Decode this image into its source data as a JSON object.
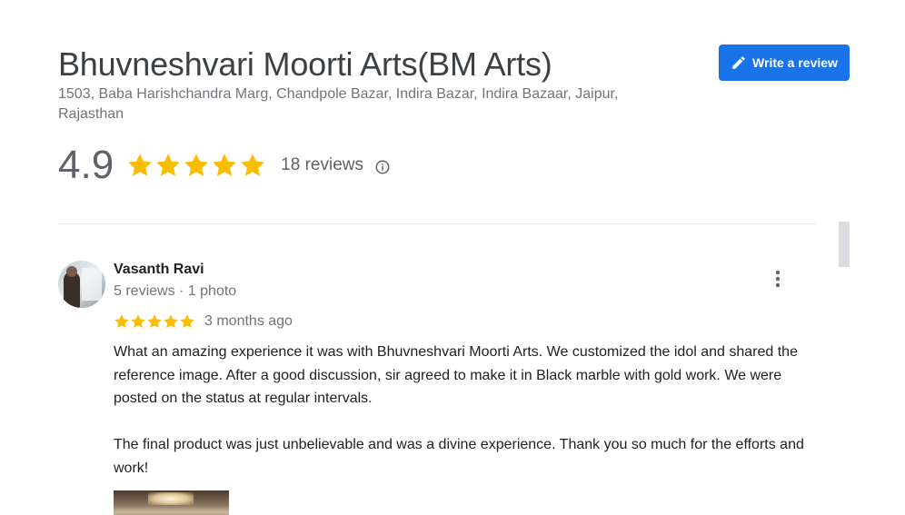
{
  "business": {
    "name": "Bhuvneshvari Moorti Arts(BM Arts)",
    "address": "1503, Baba Harishchandra Marg, Chandpole Bazar, Indira Bazar, Indira Bazaar, Jaipur, Rajasthan",
    "rating": "4.9",
    "stars": 5,
    "review_count": "18 reviews"
  },
  "actions": {
    "write_review_label": "Write a review",
    "write_review_icon": "pencil-icon"
  },
  "colors": {
    "accent": "#1a73e8",
    "star": "#fbbc04"
  },
  "reviews": [
    {
      "author": "Vasanth Ravi",
      "meta": "5 reviews · 1 photo",
      "stars": 5,
      "date": "3 months ago",
      "paragraphs": [
        "What an amazing experience it was with Bhuvneshvari Moorti Arts. We customized the idol and shared the reference image. After a good discussion, sir agreed to make it in Black marble with gold work. We were posted on the status at regular intervals.",
        "The final product was just unbelievable and was a divine experience. Thank you so much for the efforts and work!"
      ]
    }
  ]
}
